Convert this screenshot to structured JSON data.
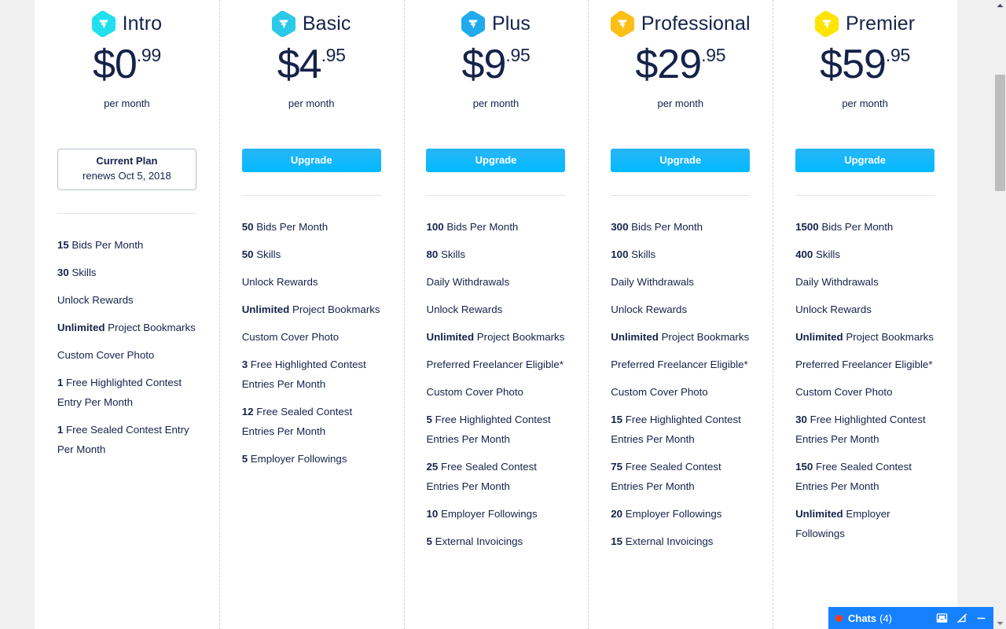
{
  "page": {
    "currency_symbol": "$",
    "per_month_label": "per month",
    "upgrade_label": "Upgrade",
    "current_plan_title": "Current Plan",
    "current_plan_renewal": "renews Oct 5, 2018",
    "accent_button_color": "#11b4f4",
    "text_color": "#15224a",
    "chat_bar_color": "#1681ff"
  },
  "plans": [
    {
      "name": "Intro",
      "badge_color": "#21dfef",
      "badge_icon": "freelancer-hexagon-icon",
      "price_main": "$0",
      "price_cents": ".99",
      "is_current": true,
      "action_label": "Current Plan",
      "features": [
        {
          "lead": "15",
          "rest": "Bids Per Month"
        },
        {
          "lead": "30",
          "rest": "Skills"
        },
        {
          "lead": "",
          "rest": "Unlock Rewards"
        },
        {
          "lead": "Unlimited",
          "rest": "Project Bookmarks"
        },
        {
          "lead": "",
          "rest": "Custom Cover Photo"
        },
        {
          "lead": "1",
          "rest": "Free Highlighted Contest Entry Per Month"
        },
        {
          "lead": "1",
          "rest": "Free Sealed Contest Entry Per Month"
        }
      ]
    },
    {
      "name": "Basic",
      "badge_color": "#29c9e8",
      "badge_icon": "freelancer-hexagon-icon",
      "price_main": "$4",
      "price_cents": ".95",
      "is_current": false,
      "action_label": "Upgrade",
      "features": [
        {
          "lead": "50",
          "rest": "Bids Per Month"
        },
        {
          "lead": "50",
          "rest": "Skills"
        },
        {
          "lead": "",
          "rest": "Unlock Rewards"
        },
        {
          "lead": "Unlimited",
          "rest": "Project Bookmarks"
        },
        {
          "lead": "",
          "rest": "Custom Cover Photo"
        },
        {
          "lead": "3",
          "rest": "Free Highlighted Contest Entries Per Month"
        },
        {
          "lead": "12",
          "rest": "Free Sealed Contest Entries Per Month"
        },
        {
          "lead": "5",
          "rest": "Employer Followings"
        }
      ]
    },
    {
      "name": "Plus",
      "badge_color": "#21aaee",
      "badge_icon": "freelancer-hexagon-icon",
      "price_main": "$9",
      "price_cents": ".95",
      "is_current": false,
      "action_label": "Upgrade",
      "features": [
        {
          "lead": "100",
          "rest": "Bids Per Month"
        },
        {
          "lead": "80",
          "rest": "Skills"
        },
        {
          "lead": "",
          "rest": "Daily Withdrawals"
        },
        {
          "lead": "",
          "rest": "Unlock Rewards"
        },
        {
          "lead": "Unlimited",
          "rest": "Project Bookmarks"
        },
        {
          "lead": "",
          "rest": "Preferred Freelancer Eligible*"
        },
        {
          "lead": "",
          "rest": "Custom Cover Photo"
        },
        {
          "lead": "5",
          "rest": "Free Highlighted Contest Entries Per Month"
        },
        {
          "lead": "25",
          "rest": "Free Sealed Contest Entries Per Month"
        },
        {
          "lead": "10",
          "rest": "Employer Followings"
        },
        {
          "lead": "5",
          "rest": "External Invoicings"
        }
      ]
    },
    {
      "name": "Professional",
      "badge_color": "#fbbf16",
      "badge_icon": "freelancer-hexagon-icon",
      "price_main": "$29",
      "price_cents": ".95",
      "is_current": false,
      "action_label": "Upgrade",
      "features": [
        {
          "lead": "300",
          "rest": "Bids Per Month"
        },
        {
          "lead": "100",
          "rest": "Skills"
        },
        {
          "lead": "",
          "rest": "Daily Withdrawals"
        },
        {
          "lead": "",
          "rest": "Unlock Rewards"
        },
        {
          "lead": "Unlimited",
          "rest": "Project Bookmarks"
        },
        {
          "lead": "",
          "rest": "Preferred Freelancer Eligible*"
        },
        {
          "lead": "",
          "rest": "Custom Cover Photo"
        },
        {
          "lead": "15",
          "rest": "Free Highlighted Contest Entries Per Month"
        },
        {
          "lead": "75",
          "rest": "Free Sealed Contest Entries Per Month"
        },
        {
          "lead": "20",
          "rest": "Employer Followings"
        },
        {
          "lead": "15",
          "rest": "External Invoicings"
        }
      ]
    },
    {
      "name": "Premier",
      "badge_color": "#ffe400",
      "badge_icon": "freelancer-hexagon-icon",
      "price_main": "$59",
      "price_cents": ".95",
      "is_current": false,
      "action_label": "Upgrade",
      "features": [
        {
          "lead": "1500",
          "rest": "Bids Per Month"
        },
        {
          "lead": "400",
          "rest": "Skills"
        },
        {
          "lead": "",
          "rest": "Daily Withdrawals"
        },
        {
          "lead": "",
          "rest": "Unlock Rewards"
        },
        {
          "lead": "Unlimited",
          "rest": "Project Bookmarks"
        },
        {
          "lead": "",
          "rest": "Preferred Freelancer Eligible*"
        },
        {
          "lead": "",
          "rest": "Custom Cover Photo"
        },
        {
          "lead": "30",
          "rest": "Free Highlighted Contest Entries Per Month"
        },
        {
          "lead": "150",
          "rest": "Free Sealed Contest Entries Per Month"
        },
        {
          "lead": "Unlimited",
          "rest": "Employer Followings"
        }
      ]
    }
  ],
  "chat": {
    "label": "Chats",
    "count": "(4)",
    "status_dot": "unread-indicator",
    "icons": [
      "inbox-icon",
      "mute-notifications-icon",
      "minimize-icon"
    ]
  },
  "scrollbar": {
    "up_arrow": "scroll-up-arrow-icon",
    "down_arrow": "scroll-down-arrow-icon"
  }
}
